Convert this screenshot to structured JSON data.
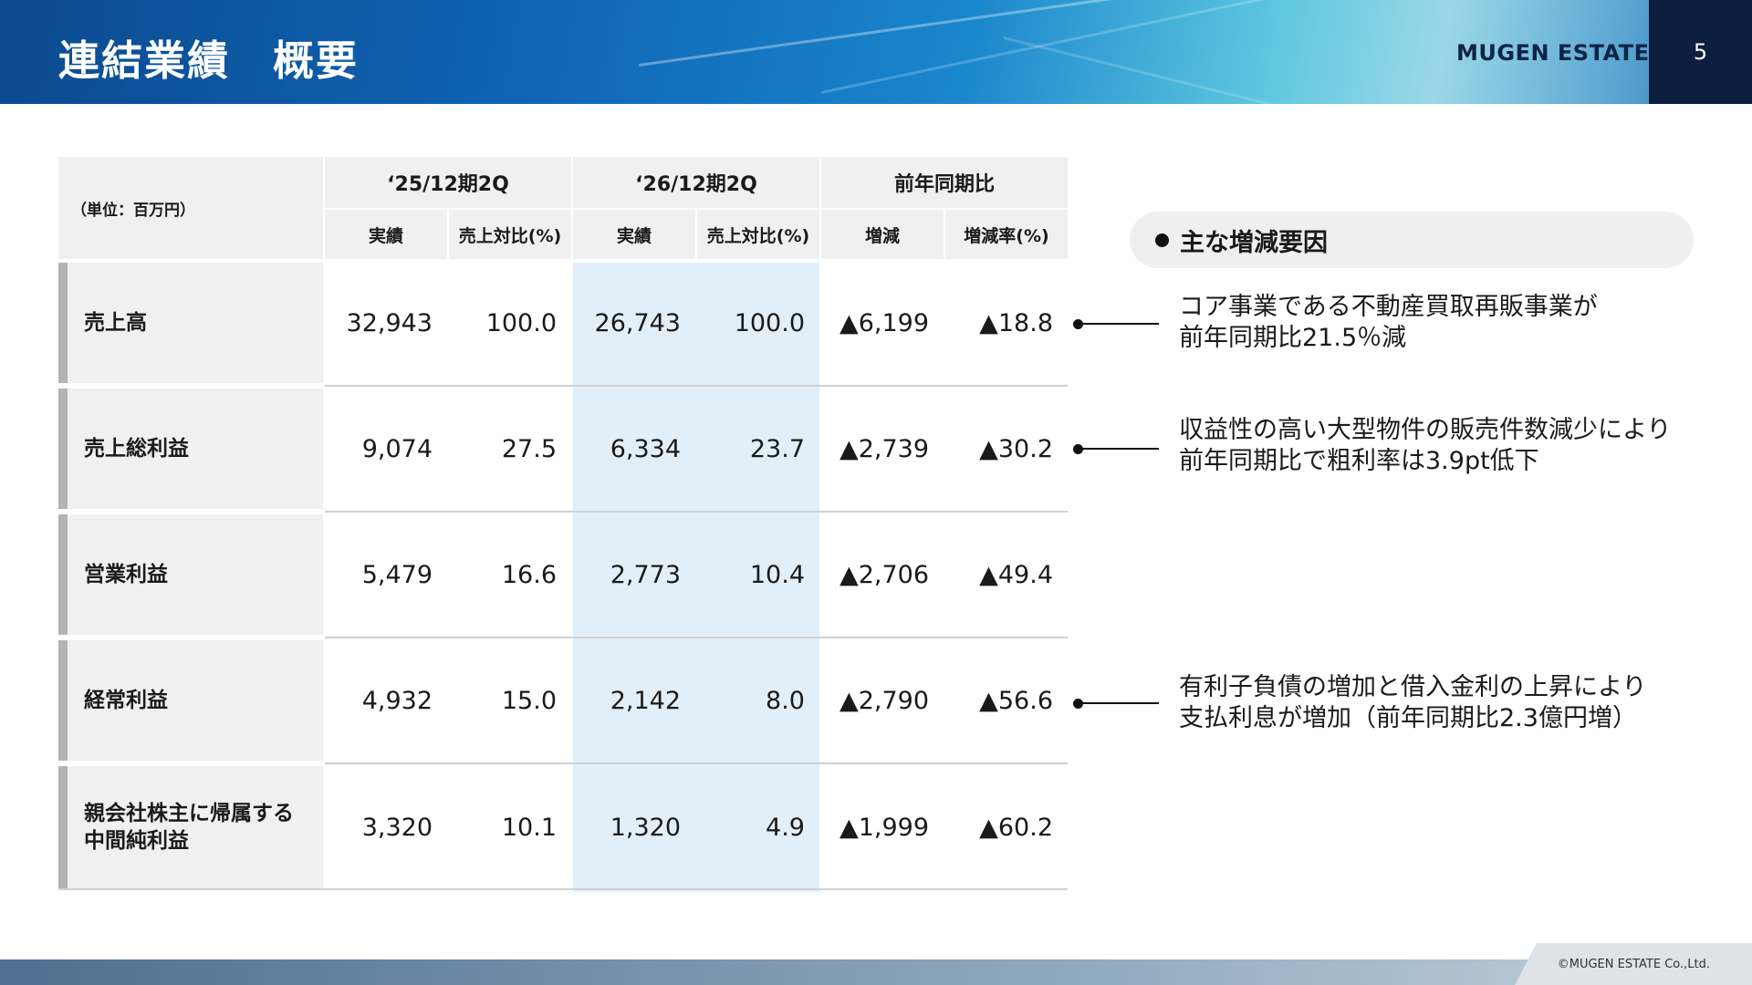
{
  "header": {
    "title": "連結業績　概要",
    "logo": "MUGEN ESTATE",
    "page_number": "5"
  },
  "table": {
    "unit": "（単位：百万円）",
    "groups": [
      "‘25/12期2Q",
      "‘26/12期2Q",
      "前年同期比"
    ],
    "subheaders": [
      "実績",
      "売上対比(%)",
      "実績",
      "売上対比(%)",
      "増減",
      "増減率(%)"
    ],
    "rows": [
      {
        "label": "売上高",
        "values": [
          "32,943",
          "100.0",
          "26,743",
          "100.0",
          "▲6,199",
          "▲18.8"
        ]
      },
      {
        "label": "売上総利益",
        "values": [
          "9,074",
          "27.5",
          "6,334",
          "23.7",
          "▲2,739",
          "▲30.2"
        ]
      },
      {
        "label": "営業利益",
        "values": [
          "5,479",
          "16.6",
          "2,773",
          "10.4",
          "▲2,706",
          "▲49.4"
        ]
      },
      {
        "label": "経常利益",
        "values": [
          "4,932",
          "15.0",
          "2,142",
          "8.0",
          "▲2,790",
          "▲56.6"
        ]
      },
      {
        "label": "親会社株主に帰属する\n中間純利益",
        "values": [
          "3,320",
          "10.1",
          "1,320",
          "4.9",
          "▲1,999",
          "▲60.2"
        ]
      }
    ]
  },
  "factors": {
    "heading": "主な増減要因",
    "notes": [
      {
        "line1": "コア事業である不動産買取再販事業が",
        "line2": "前年同期比21.5％減"
      },
      {
        "line1": "収益性の高い大型物件の販売件数減少により",
        "line2": "前年同期比で粗利率は3.9pt低下"
      },
      {
        "line1": "有利子負債の増加と借入金利の上昇により",
        "line2": "支払利息が増加（前年同期比2.3億円増）"
      }
    ]
  },
  "footer": {
    "copyright": "©MUGEN ESTATE Co.,Ltd."
  }
}
